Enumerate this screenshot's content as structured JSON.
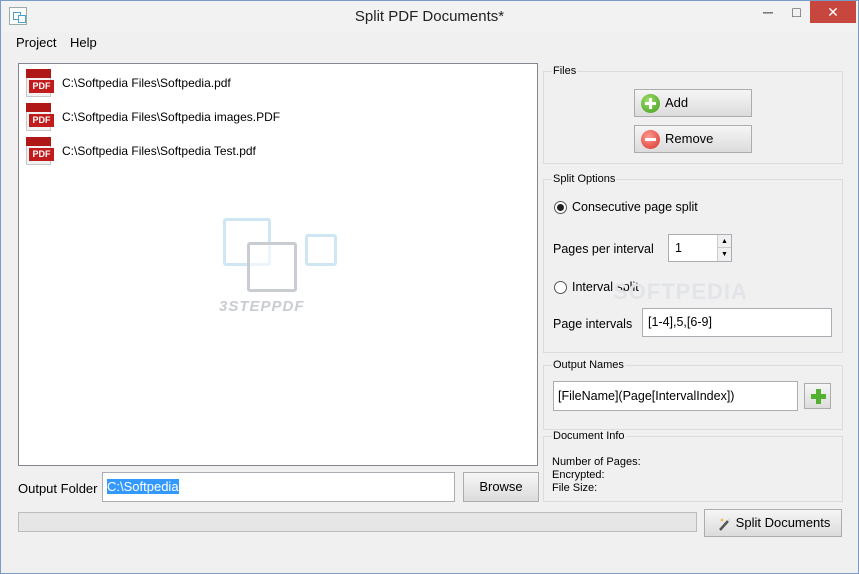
{
  "window": {
    "title": "Split PDF Documents*",
    "minimize": "─",
    "maximize": "□",
    "close": "✕"
  },
  "menu": {
    "project": "Project",
    "help": "Help"
  },
  "files": [
    {
      "icon": "pdf-icon",
      "icon_text": "PDF",
      "path": "C:\\Softpedia Files\\Softpedia.pdf"
    },
    {
      "icon": "pdf-icon",
      "icon_text": "PDF",
      "path": "C:\\Softpedia Files\\Softpedia images.PDF"
    },
    {
      "icon": "pdf-icon",
      "icon_text": "PDF",
      "path": "C:\\Softpedia Files\\Softpedia Test.pdf"
    }
  ],
  "watermark": {
    "text": "3STEPPDF"
  },
  "output": {
    "label": "Output Folder",
    "value": "C:\\Softpedia",
    "browse": "Browse"
  },
  "progress": {
    "value": 0
  },
  "split_button": {
    "label": "Split Documents",
    "icon": "magic-wand-icon"
  },
  "files_group": {
    "title": "Files",
    "add": "Add",
    "remove": "Remove"
  },
  "split_options": {
    "title": "Split Options",
    "consecutive": "Consecutive page split",
    "consecutive_checked": true,
    "pages_per_interval_label": "Pages per interval",
    "pages_per_interval": "1",
    "interval_split": "Interval split",
    "interval_checked": false,
    "page_intervals_label": "Page intervals",
    "page_intervals": "[1-4],5,[6-9]"
  },
  "output_names": {
    "title": "Output Names",
    "value": "[FileName](Page[IntervalIndex])"
  },
  "doc_info": {
    "title": "Document Info",
    "pages": "Number of Pages:",
    "encrypted": "Encrypted:",
    "size": "File Size:"
  },
  "brand_watermark": "SOFTPEDIA",
  "colors": {
    "close_button": "#c7463d",
    "selection": "#3399ff",
    "pdf_red": "#c11b1b",
    "add_green": "#54b030"
  }
}
